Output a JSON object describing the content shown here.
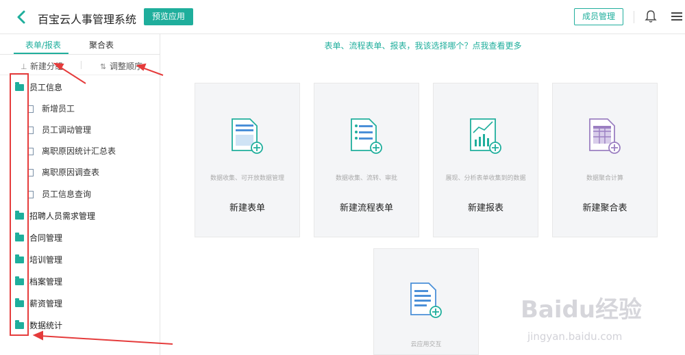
{
  "header": {
    "title": "百宝云人事管理系统",
    "preview_label": "预览应用",
    "members_label": "成员管理"
  },
  "sidebar": {
    "tabs": [
      {
        "label": "表单/报表",
        "active": true
      },
      {
        "label": "聚合表",
        "active": false
      }
    ],
    "new_group_label": "新建分组",
    "reorder_label": "调整顺序",
    "tree": [
      {
        "label": "员工信息",
        "type": "folder",
        "children": [
          {
            "label": "新增员工",
            "icon": "form-icon"
          },
          {
            "label": "员工调动管理",
            "icon": "report-icon"
          },
          {
            "label": "离职原因统计汇总表",
            "icon": "report-icon"
          },
          {
            "label": "离职原因调查表",
            "icon": "form-icon"
          },
          {
            "label": "员工信息查询",
            "icon": "report-icon"
          }
        ]
      },
      {
        "label": "招聘人员需求管理",
        "type": "folder"
      },
      {
        "label": "合同管理",
        "type": "folder"
      },
      {
        "label": "培训管理",
        "type": "folder"
      },
      {
        "label": "档案管理",
        "type": "folder"
      },
      {
        "label": "薪资管理",
        "type": "folder"
      },
      {
        "label": "数据统计",
        "type": "folder"
      }
    ]
  },
  "main": {
    "hint": "表单、流程表单、报表，我该选择哪个？点我查看更多",
    "cards": [
      {
        "desc": "数据收集、可开放数据管理",
        "name": "新建表单",
        "icon": "new-form-icon"
      },
      {
        "desc": "数据收集、流转、审批",
        "name": "新建流程表单",
        "icon": "new-flow-form-icon"
      },
      {
        "desc": "展现、分析表单收集到的数据",
        "name": "新建报表",
        "icon": "new-report-icon"
      },
      {
        "desc": "数据聚合计算",
        "name": "新建聚合表",
        "icon": "new-aggregate-icon"
      },
      {
        "desc": "云应用交互",
        "name": "",
        "icon": "cloud-interaction-icon"
      }
    ]
  },
  "watermark": {
    "brand": "Baidu经验",
    "url": "jingyan.baidu.com"
  },
  "colors": {
    "accent": "#1fae9c",
    "annotation": "#e53b3b",
    "purple": "#9b7fc1"
  }
}
